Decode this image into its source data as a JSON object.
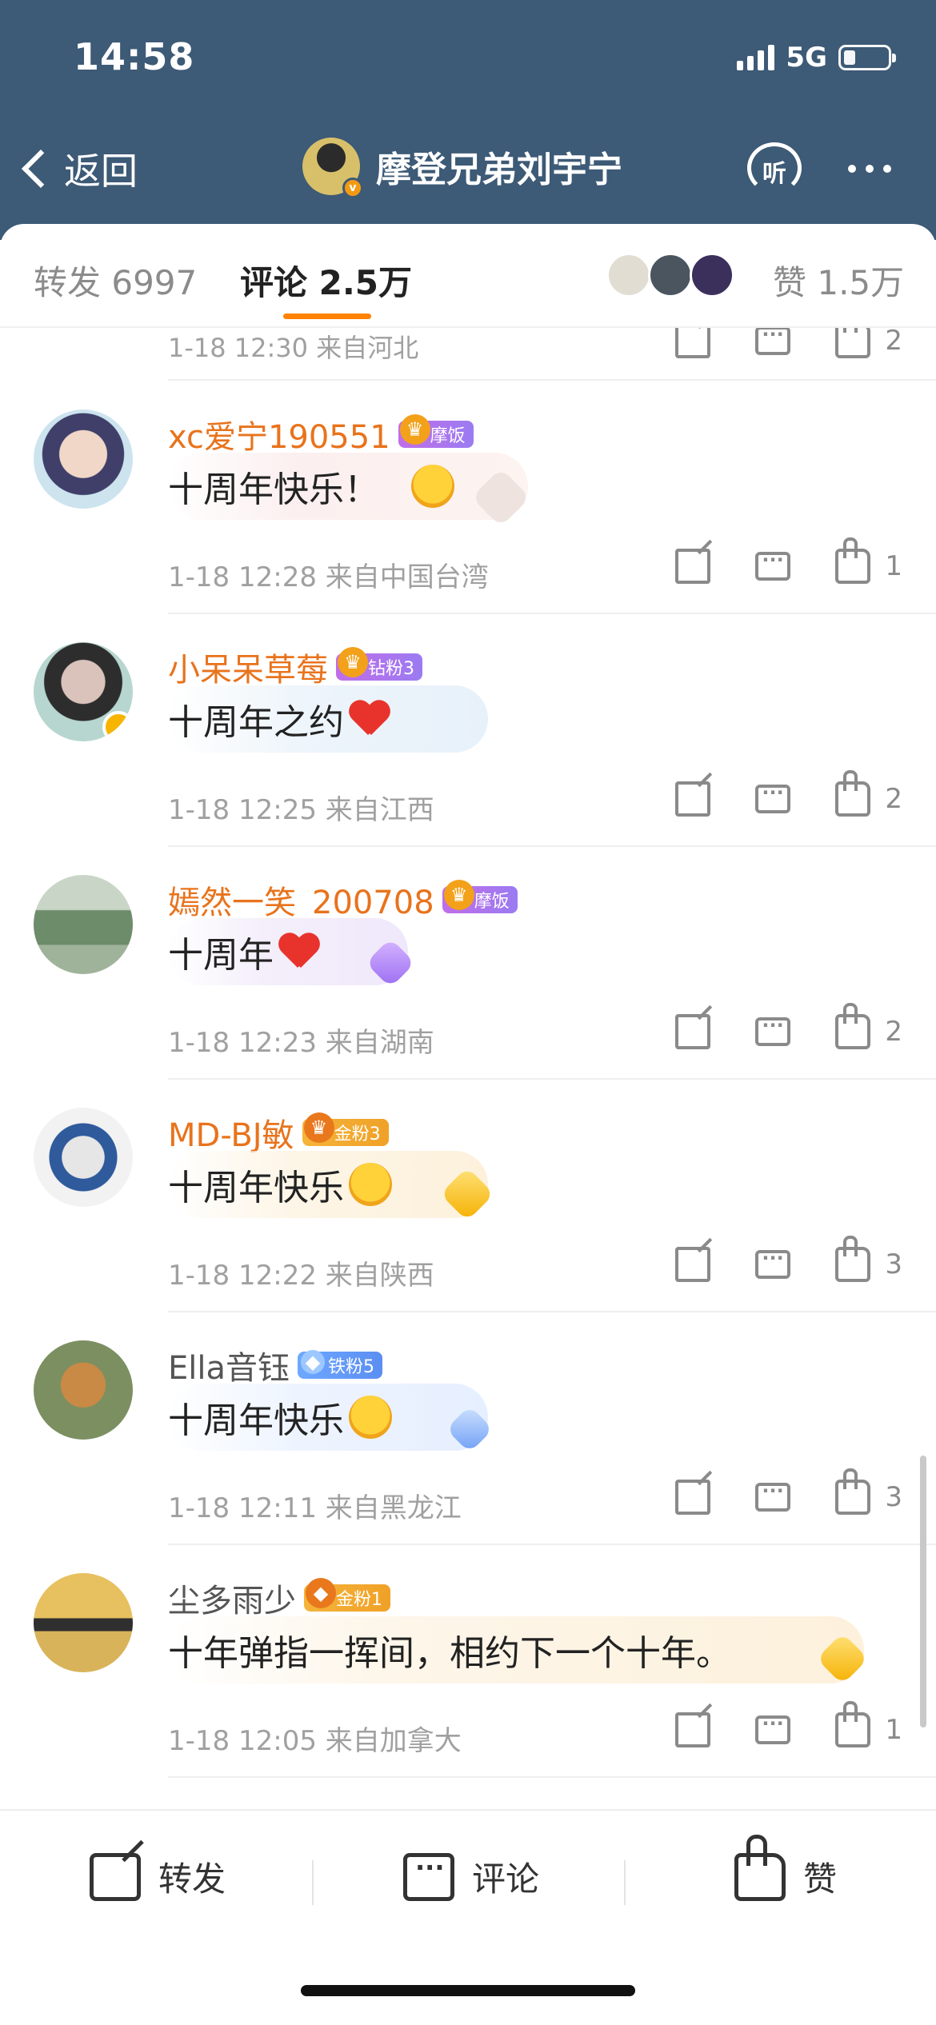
{
  "status_bar": {
    "time": "14:58",
    "network": "5G"
  },
  "nav": {
    "back_label": "返回",
    "title": "摩登兄弟刘宇宁",
    "listen_label": "听"
  },
  "tabs": {
    "repost_label": "转发 6997",
    "comment_label": "评论 2.5万",
    "like_label": "赞 1.5万"
  },
  "previous_item": {
    "meta": "1-18 12:30  来自河北",
    "likes": "2"
  },
  "comments": [
    {
      "name": "xc爱宁190551",
      "name_color": "#e8731c",
      "badge": "摩饭",
      "badge_style": "purple",
      "text": "十周年快乐！",
      "meta": "1-18 12:28  来自中国台湾",
      "likes": "1"
    },
    {
      "name": "小呆呆草莓",
      "name_color": "#e8731c",
      "badge": "钻粉3",
      "badge_style": "purple",
      "text": "十周年之约",
      "meta": "1-18 12:25  来自江西",
      "likes": "2"
    },
    {
      "name": "嫣然一笑_200708",
      "name_color": "#e8731c",
      "badge": "摩饭",
      "badge_style": "purple",
      "text": "十周年",
      "meta": "1-18 12:23  来自湖南",
      "likes": "2"
    },
    {
      "name": "MD-BJ敏",
      "name_color": "#e8731c",
      "badge": "金粉3",
      "badge_style": "gold",
      "text": "十周年快乐",
      "meta": "1-18 12:22  来自陕西",
      "likes": "3"
    },
    {
      "name": "Ella音钰",
      "name_color": "#555555",
      "badge": "铁粉5",
      "badge_style": "blue",
      "text": "十周年快乐",
      "meta": "1-18 12:11  来自黑龙江",
      "likes": "3"
    },
    {
      "name": "尘多雨少",
      "name_color": "#555555",
      "badge": "金粉1",
      "badge_style": "gold",
      "text": "十年弹指一挥间，相约下一个十年。",
      "meta": "1-18 12:05  来自加拿大",
      "likes": "1"
    }
  ],
  "bottom_bar": {
    "repost": "转发",
    "comment": "评论",
    "like": "赞"
  },
  "colors": {
    "header_bg": "#3d5a76",
    "accent": "#ff8200",
    "username": "#e8731c"
  }
}
